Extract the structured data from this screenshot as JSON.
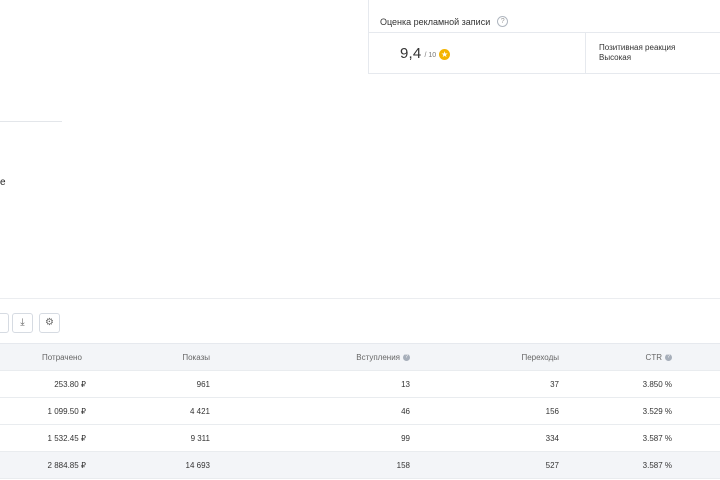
{
  "score_card": {
    "title": "Оценка рекламной записи",
    "help_icon": "?",
    "score": "9,4",
    "score_max": "/ 10",
    "score_icon": "star-badge-icon",
    "reaction_label": "Позитивная реакция",
    "reaction_value": "Высокая"
  },
  "fragment_text": "е",
  "toolbar": {
    "download_icon": "⤓",
    "settings_icon": "⚙"
  },
  "table": {
    "headers": [
      "Потрачено",
      "Показы",
      "Вступления",
      "Переходы",
      "CTR"
    ],
    "rows": [
      [
        "253.80 ₽",
        "961",
        "13",
        "37",
        "3.850 %"
      ],
      [
        "1 099.50 ₽",
        "4 421",
        "46",
        "156",
        "3.529 %"
      ],
      [
        "1 532.45 ₽",
        "9 311",
        "99",
        "334",
        "3.587 %"
      ]
    ],
    "total": [
      "2 884.85 ₽",
      "14 693",
      "158",
      "527",
      "3.587 %"
    ]
  },
  "colors": {
    "accent_star": "#f4b400",
    "header_bg": "#f3f5f8"
  }
}
